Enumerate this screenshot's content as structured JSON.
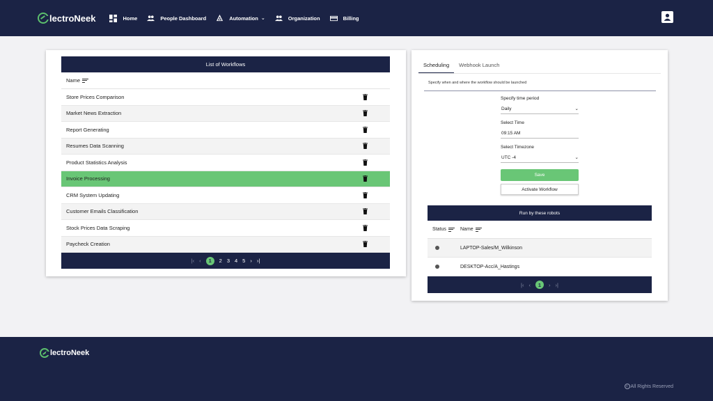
{
  "nav": {
    "brand": "lectroNeek",
    "items": [
      {
        "label": "Home",
        "icon": "dashboard-icon"
      },
      {
        "label": "People Dashboard",
        "icon": "people-icon"
      },
      {
        "label": "Automation",
        "icon": "robot-icon"
      },
      {
        "label": "Organization",
        "icon": "people-icon"
      },
      {
        "label": "Billing",
        "icon": "card-icon"
      }
    ]
  },
  "workflows": {
    "title": "List of Workflows",
    "column": "Name",
    "rows": [
      "Store Prices Comparison",
      "Market News Extraction",
      "Report Generating",
      "Resumes Data Scanning",
      "Product Statistics Analysis",
      "Invoice Processing",
      "CRM System Updating",
      "Customer Emails Classification",
      "Stock Prices Data Scraping",
      "Paycheck Creation"
    ],
    "selected_index": 5,
    "pages": [
      "1",
      "2",
      "3",
      "4",
      "5"
    ],
    "current_page": "1"
  },
  "scheduling": {
    "tabs": [
      "Scheduling",
      "Webhook Launch"
    ],
    "description": "Specify when and where the workflow should be launched",
    "period_label": "Specify time period",
    "period_value": "Daily",
    "time_label": "Select Time",
    "time_value": "09:15 AM",
    "tz_label": "Select Timezone",
    "tz_value": "UTC -4",
    "save_label": "Save",
    "activate_label": "Activate Workflow"
  },
  "robots": {
    "title": "Run by these robots",
    "col_status": "Status",
    "col_name": "Name",
    "rows": [
      "LAPTOP-Sales/M_Wilkinson",
      "DESKTOP-Acc/A_Hastings"
    ],
    "current_page": "1"
  },
  "footer": {
    "brand": "lectroNeek",
    "copyright": "All Rights Reserved"
  },
  "colors": {
    "navy": "#1b2345",
    "accent_green": "#69c676"
  }
}
